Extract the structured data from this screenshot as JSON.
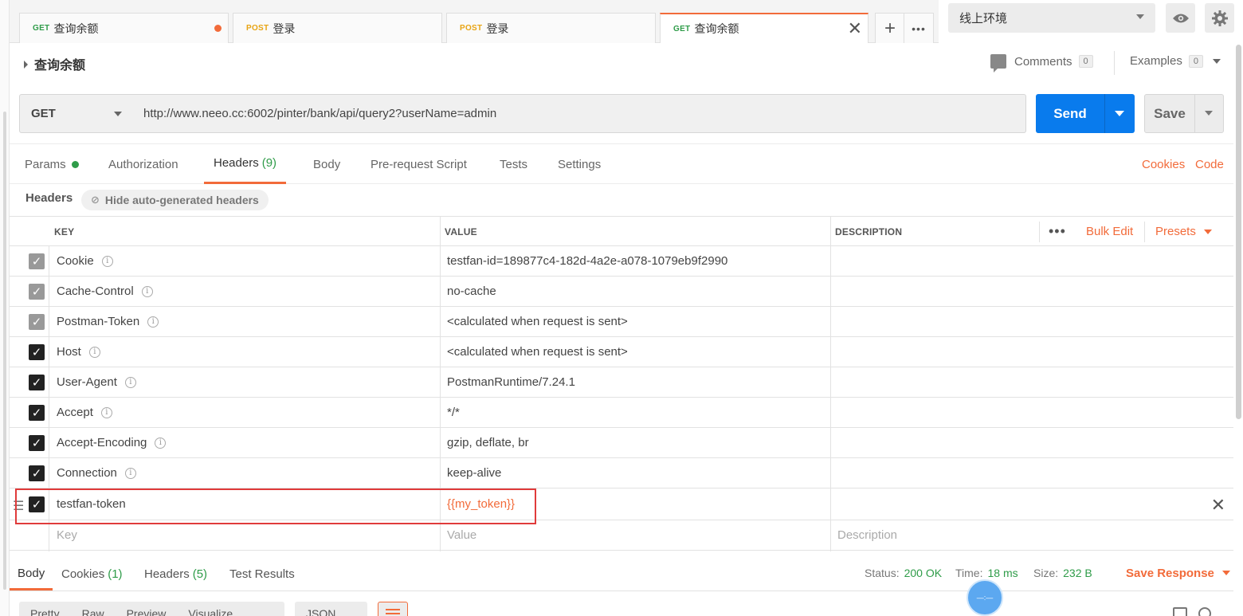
{
  "tabs": [
    {
      "method": "GET",
      "name": "查询余额",
      "unsaved": true,
      "active": false
    },
    {
      "method": "POST",
      "name": "登录",
      "unsaved": false,
      "active": false
    },
    {
      "method": "POST",
      "name": "登录",
      "unsaved": false,
      "active": false
    },
    {
      "method": "GET",
      "name": "查询余额",
      "unsaved": false,
      "active": true
    }
  ],
  "tab_actions": {
    "add": "+",
    "more": "•••",
    "close": "✕"
  },
  "environment": {
    "selected": "线上环境"
  },
  "request": {
    "name": "查询余额",
    "comments_label": "Comments",
    "comments_count": "0",
    "examples_label": "Examples",
    "examples_count": "0",
    "method": "GET",
    "url": "http://www.neeo.cc:6002/pinter/bank/api/query2?userName=admin",
    "send_label": "Send",
    "save_label": "Save"
  },
  "request_tabs": {
    "params": "Params",
    "authorization": "Authorization",
    "headers": "Headers",
    "headers_count": "(9)",
    "body": "Body",
    "prerequest": "Pre-request Script",
    "tests": "Tests",
    "settings": "Settings",
    "cookies": "Cookies",
    "code": "Code"
  },
  "headers_bar": {
    "title": "Headers",
    "hide_label": "Hide auto-generated headers"
  },
  "table": {
    "col_key": "KEY",
    "col_value": "VALUE",
    "col_description": "DESCRIPTION",
    "more": "•••",
    "bulk_edit": "Bulk Edit",
    "presets": "Presets",
    "rows": [
      {
        "key": "Cookie",
        "value": "testfan-id=189877c4-182d-4a2e-a078-1079eb9f2990",
        "auto": true
      },
      {
        "key": "Cache-Control",
        "value": "no-cache",
        "auto": true
      },
      {
        "key": "Postman-Token",
        "value": "<calculated when request is sent>",
        "auto": true
      },
      {
        "key": "Host",
        "value": "<calculated when request is sent>",
        "auto": false
      },
      {
        "key": "User-Agent",
        "value": "PostmanRuntime/7.24.1",
        "auto": false
      },
      {
        "key": "Accept",
        "value": "*/*",
        "auto": false
      },
      {
        "key": "Accept-Encoding",
        "value": "gzip, deflate, br",
        "auto": false
      },
      {
        "key": "Connection",
        "value": "keep-alive",
        "auto": false
      }
    ],
    "custom_row": {
      "key": "testfan-token",
      "value": "{{my_token}}"
    },
    "placeholder": {
      "key": "Key",
      "value": "Value",
      "description": "Description"
    }
  },
  "response": {
    "tabs": {
      "body": "Body",
      "cookies": "Cookies",
      "cookies_count": "(1)",
      "headers": "Headers",
      "headers_count": "(5)",
      "tests": "Test Results"
    },
    "status_label": "Status:",
    "status": "200 OK",
    "time_label": "Time:",
    "time": "18 ms",
    "size_label": "Size:",
    "size": "232 B",
    "save_response": "Save Response",
    "format_buttons": [
      "Pretty",
      "Raw",
      "Preview",
      "Visualize"
    ],
    "format_select": "JSON"
  },
  "colors": {
    "accent": "#f26b3a",
    "send": "#097bed",
    "get": "#2f9c49",
    "post": "#e8a413",
    "highlight": "#e03b3b"
  }
}
